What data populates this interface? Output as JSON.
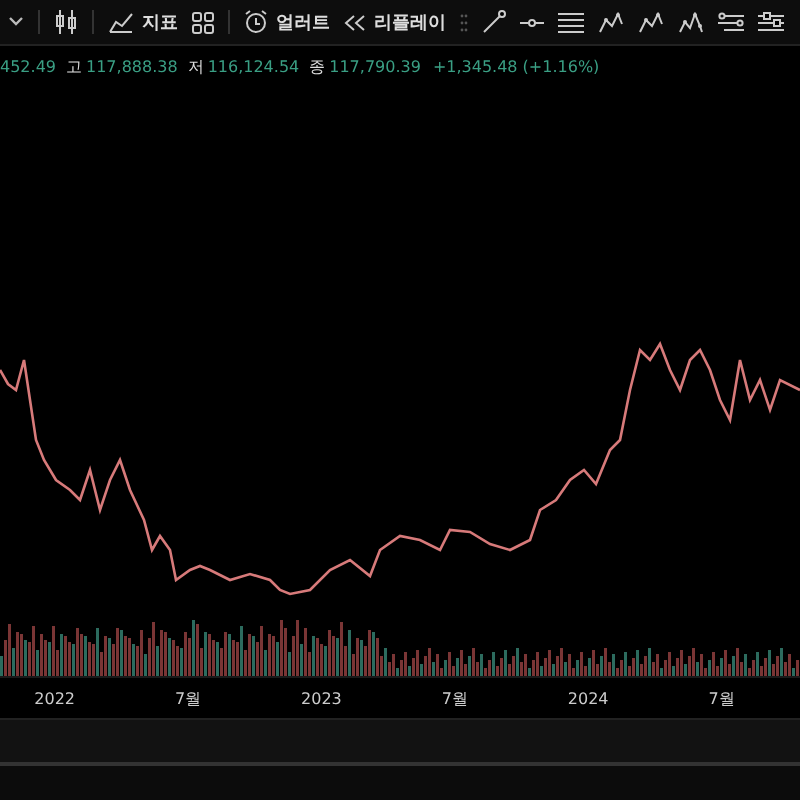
{
  "toolbar": [
    {
      "kind": "chevron"
    },
    {
      "kind": "candles"
    },
    {
      "kind": "indicator",
      "label": "지표"
    },
    {
      "kind": "grid"
    },
    {
      "kind": "alert",
      "label": "얼러트"
    },
    {
      "kind": "replay",
      "label": "리플레이"
    },
    {
      "kind": "handle"
    },
    {
      "kind": "trendline"
    },
    {
      "kind": "hline"
    },
    {
      "kind": "lines"
    },
    {
      "kind": "pattern"
    },
    {
      "kind": "pattern2"
    },
    {
      "kind": "pattern3"
    },
    {
      "kind": "channel"
    },
    {
      "kind": "sliders"
    }
  ],
  "ohlc": [
    {
      "value": "452.49"
    },
    {
      "label": "고",
      "value": "117,888.38"
    },
    {
      "label": "저",
      "value": "116,124.54"
    },
    {
      "label": "종",
      "value": "117,790.39"
    }
  ],
  "change": "+1,345.48 (+1.16%)",
  "time_axis": [
    "2022",
    "7월",
    "2023",
    "7월",
    "2024",
    "7월"
  ]
}
